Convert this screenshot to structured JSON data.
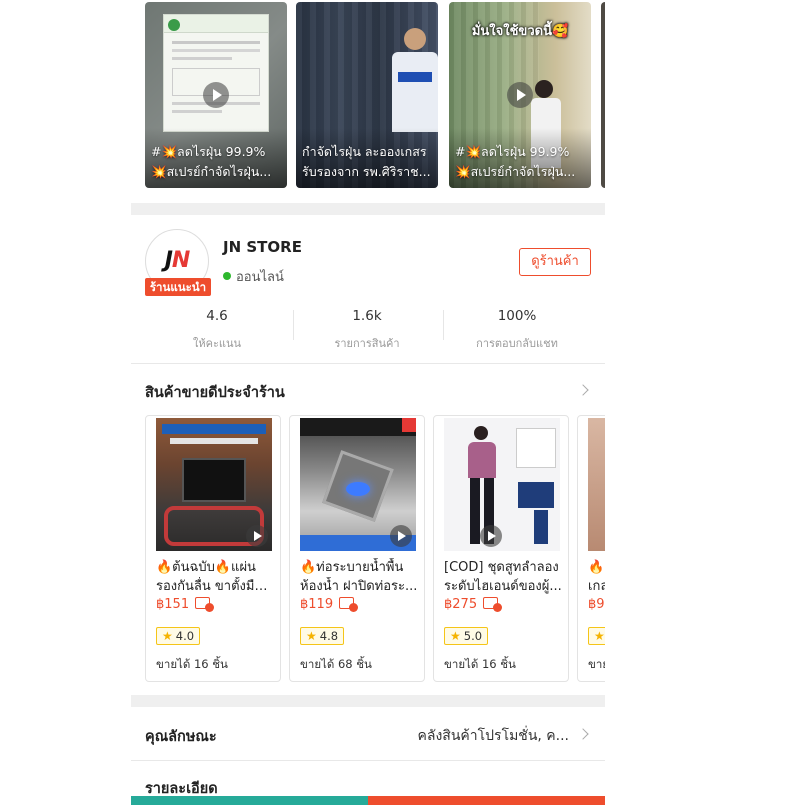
{
  "videos": [
    {
      "caption_line1": "#💥ลดไรฝุ่น 99.9%",
      "caption_line2": "💥สเปรย์กำจัดไรฝุ่น...",
      "top_tag": ""
    },
    {
      "caption_line1": "กำจัดไรฝุ่น ละอองเกสร",
      "caption_line2": "รับรองจาก รพ.ศิริราช...",
      "top_tag": ""
    },
    {
      "caption_line1": "#💥ลดไรฝุ่น 99.9%",
      "caption_line2": "💥สเปรย์กำจัดไรฝุ่น...",
      "top_tag": "มั่นใจใช้ขวดนี้🥰"
    }
  ],
  "store": {
    "logo_text_main": "JN",
    "name": "JN STORE",
    "status": "ออนไลน์",
    "badge": "ร้านแนะนำ",
    "view_shop_label": "ดูร้านค้า",
    "stats": [
      {
        "value": "4.6",
        "label": "ให้คะแนน"
      },
      {
        "value": "1.6k",
        "label": "รายการสินค้า"
      },
      {
        "value": "100%",
        "label": "การตอบกลับแชท"
      }
    ]
  },
  "bestsellers": {
    "title": "สินค้าขายดีประจำร้าน",
    "products": [
      {
        "name_line1": "🔥ต้นฉบับ🔥แผ่น",
        "name_line2": "รองกันลื่น ขาตั้งมือ...",
        "price": "฿151",
        "rating": "4.0",
        "sold": "ขายได้ 16 ชิ้น"
      },
      {
        "name_line1": "🔥ท่อระบายน้ำพื้น",
        "name_line2": "ห้องน้ำ ฝาปิดท่อระ...",
        "price": "฿119",
        "rating": "4.8",
        "sold": "ขายได้ 68 ชิ้น"
      },
      {
        "name_line1": "[COD] ชุดสูทลำลอง",
        "name_line2": "ระดับไฮเอนด์ของผู้...",
        "price": "฿275",
        "rating": "5.0",
        "sold": "ขายได้ 16 ชิ้น"
      },
      {
        "name_line1": "🔥",
        "name_line2": "เกล",
        "price": "฿9",
        "rating": "",
        "sold": "ขาย"
      }
    ]
  },
  "attributes": {
    "label": "คุณลักษณะ",
    "value": "คลังสินค้าโปรโมชั่น, ค..."
  },
  "details": {
    "label": "รายละเอียด"
  },
  "colors": {
    "brand": "#ee4d2d",
    "online": "#2eb82e",
    "chat_bar": "#26aa99"
  }
}
